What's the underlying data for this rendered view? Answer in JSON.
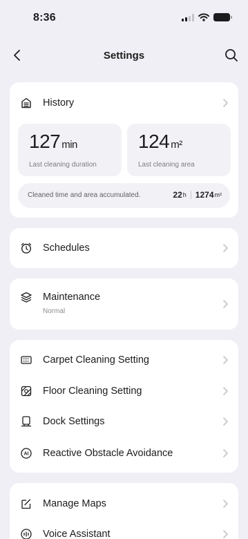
{
  "status_bar": {
    "time": "8:36"
  },
  "nav": {
    "title": "Settings"
  },
  "history": {
    "label": "History",
    "duration": {
      "value": "127",
      "unit": "min",
      "label": "Last cleaning duration"
    },
    "area": {
      "value": "124",
      "unit": "m²",
      "label": "Last cleaning area"
    },
    "accumulated": {
      "label": "Cleaned time and area accumulated.",
      "time_value": "22",
      "time_unit": "h",
      "area_value": "1274",
      "area_unit": "m²"
    }
  },
  "schedules": {
    "label": "Schedules"
  },
  "maintenance": {
    "label": "Maintenance",
    "status": "Normal"
  },
  "cleaning_settings": {
    "items": [
      {
        "label": "Carpet Cleaning Setting",
        "icon": "carpet-icon"
      },
      {
        "label": "Floor Cleaning Setting",
        "icon": "floor-icon"
      },
      {
        "label": "Dock Settings",
        "icon": "dock-icon"
      },
      {
        "label": "Reactive Obstacle Avoidance",
        "icon": "ai-icon"
      }
    ]
  },
  "more": {
    "items": [
      {
        "label": "Manage Maps",
        "icon": "map-icon"
      },
      {
        "label": "Voice Assistant",
        "icon": "voice-icon"
      }
    ]
  }
}
